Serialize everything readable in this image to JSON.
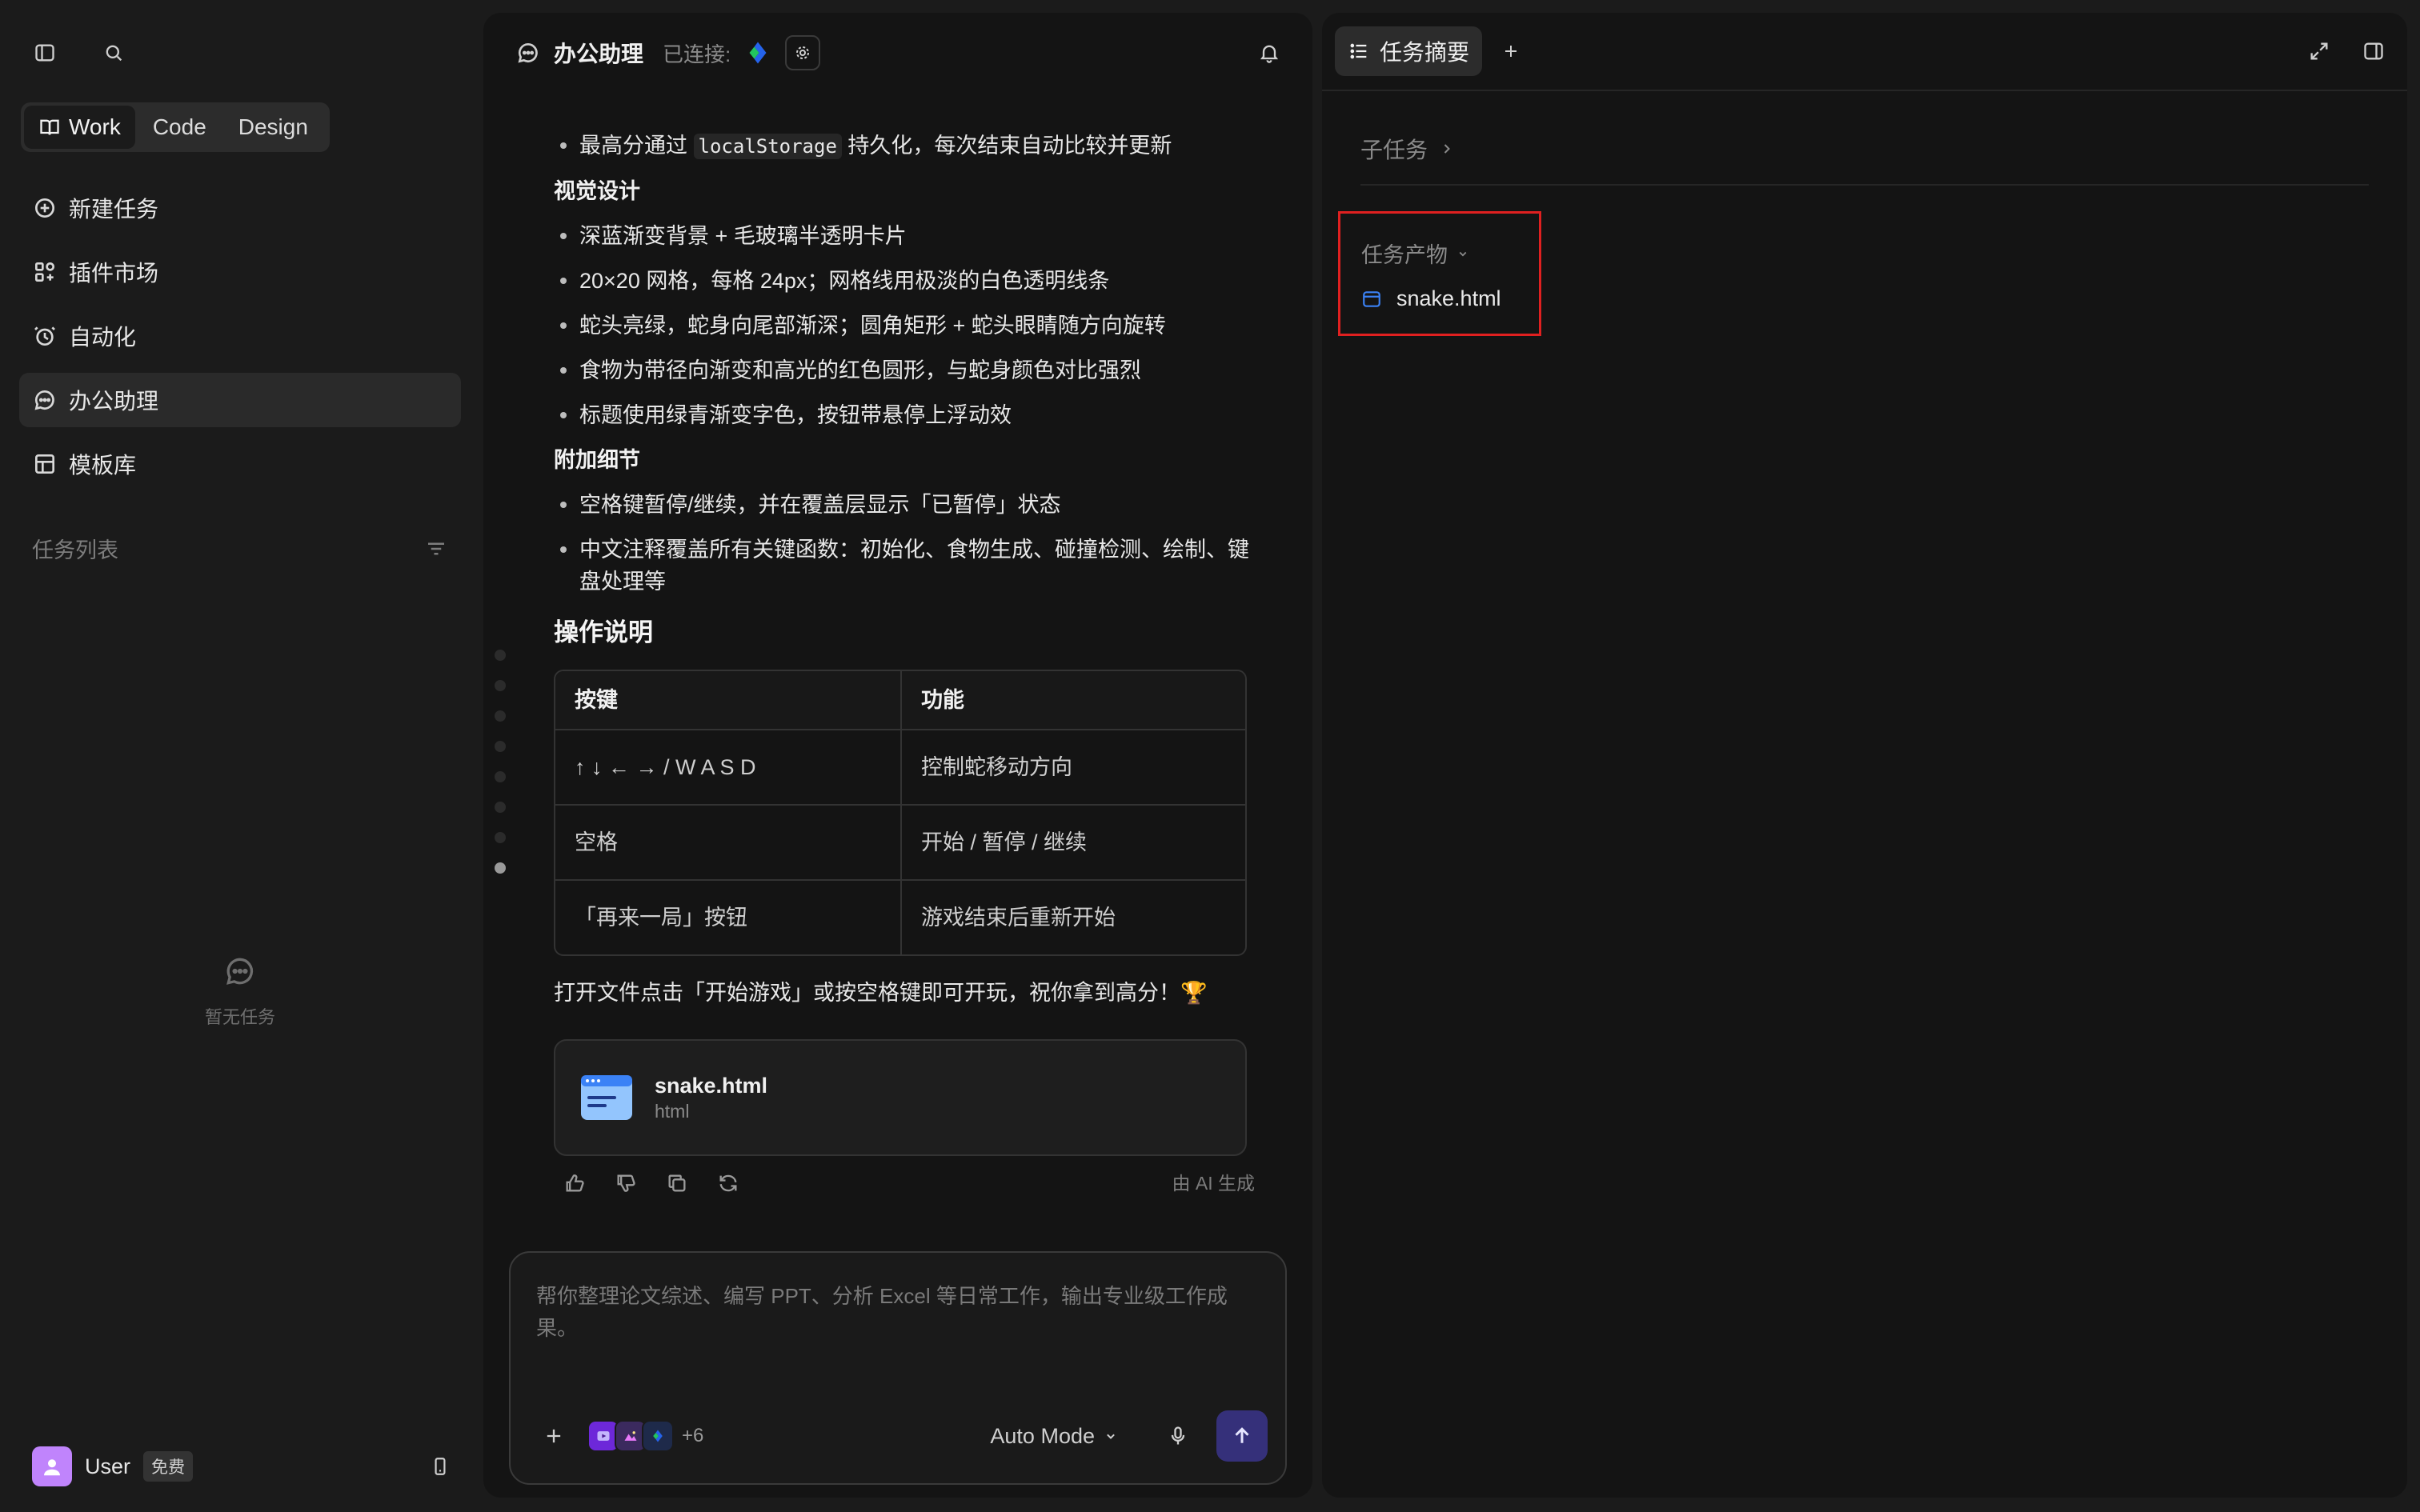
{
  "sidebar": {
    "modes": [
      "Work",
      "Code",
      "Design"
    ],
    "nav": [
      {
        "label": "新建任务",
        "icon": "plus-circle-icon"
      },
      {
        "label": "插件市场",
        "icon": "plugins-icon"
      },
      {
        "label": "自动化",
        "icon": "clock-icon"
      },
      {
        "label": "办公助理",
        "icon": "chat-bubble-icon"
      },
      {
        "label": "模板库",
        "icon": "template-icon"
      }
    ],
    "task_list_label": "任务列表",
    "empty_label": "暂无任务",
    "user": {
      "name": "User",
      "plan": "免费"
    }
  },
  "chat": {
    "title": "办公助理",
    "status": "已连接:",
    "content": {
      "line_top_pre": "最高分通过",
      "line_top_code": "localStorage",
      "line_top_post": "持久化，每次结束自动比较并更新",
      "visual_heading": "视觉设计",
      "visual_items": [
        "深蓝渐变背景 + 毛玻璃半透明卡片",
        "20×20 网格，每格 24px；网格线用极淡的白色透明线条",
        "蛇头亮绿，蛇身向尾部渐深；圆角矩形 + 蛇头眼睛随方向旋转",
        "食物为带径向渐变和高光的红色圆形，与蛇身颜色对比强烈",
        "标题使用绿青渐变字色，按钮带悬停上浮动效"
      ],
      "extra_heading": "附加细节",
      "extra_items": [
        "空格键暂停/继续，并在覆盖层显示「已暂停」状态",
        "中文注释覆盖所有关键函数：初始化、食物生成、碰撞检测、绘制、键盘处理等"
      ],
      "ops_heading": "操作说明",
      "table": {
        "headers": [
          "按键",
          "功能"
        ],
        "rows": [
          [
            "↑ ↓ ← → / W A S D",
            "控制蛇移动方向"
          ],
          [
            "空格",
            "开始 / 暂停 / 继续"
          ],
          [
            "「再来一局」按钮",
            "游戏结束后重新开始"
          ]
        ]
      },
      "closing": "打开文件点击「开始游戏」或按空格键即可开玩，祝你拿到高分！🏆",
      "file": {
        "name": "snake.html",
        "type": "html"
      },
      "ai_tag": "由 AI 生成"
    },
    "composer": {
      "placeholder": "帮你整理论文综述、编写 PPT、分析 Excel 等日常工作，输出专业级工作成果。",
      "more_tools": "+6",
      "mode": "Auto Mode"
    }
  },
  "right_panel": {
    "tab_label": "任务摘要",
    "subtask_label": "子任务",
    "artifacts_label": "任务产物",
    "artifact_file": "snake.html",
    "highlight_color": "#e02020"
  }
}
